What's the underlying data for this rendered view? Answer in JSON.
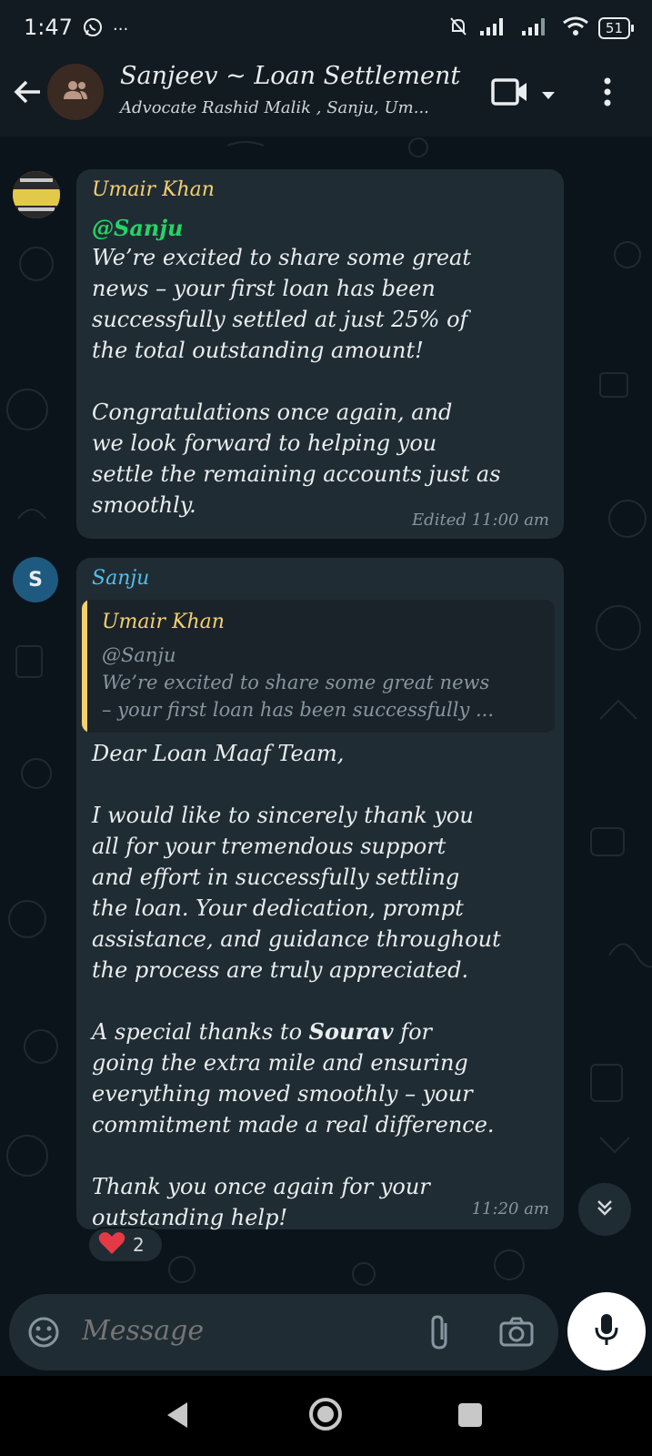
{
  "status_bar": {
    "time": "1:47",
    "more": "···",
    "battery": "51"
  },
  "header": {
    "title": "Sanjeev ~ Loan Settlement",
    "subtitle": "Advocate Rashid Malik , Sanju, Um..."
  },
  "messages": [
    {
      "sender": "Umair Khan",
      "sender_color": "#f7cf6f",
      "mention": "@Sanju",
      "text": "We’re excited to share some great\nnews – your first loan has been\nsuccessfully settled at just 25% of\nthe total outstanding amount!\n\nCongratulations once again, and\nwe look forward to helping you\nsettle the remaining accounts just as\nsmoothly.",
      "meta": "Edited 11:00 am"
    },
    {
      "sender": "Sanju",
      "sender_color": "#53bdeb",
      "avatar_letter": "S",
      "quote": {
        "sender": "Umair Khan",
        "text": "@Sanju\nWe’re excited to share some great news\n– your first loan has been successfully ..."
      },
      "text_part1": "Dear Loan Maaf Team,\n\nI would like to sincerely thank you\nall for your tremendous support\nand effort in successfully settling\nthe loan. Your dedication, prompt\nassistance, and guidance throughout\nthe process are truly appreciated.\n\nA special thanks to ",
      "text_bold": "Sourav",
      "text_part2": " for\ngoing the extra mile and ensuring\neverything moved smoothly – your\ncommitment made a real difference.\n\nThank you once again for your\noutstanding help!",
      "meta": "11:20 am",
      "reaction": {
        "emoji": "❤️",
        "count": "2"
      }
    }
  ],
  "composer": {
    "placeholder": "Message"
  }
}
